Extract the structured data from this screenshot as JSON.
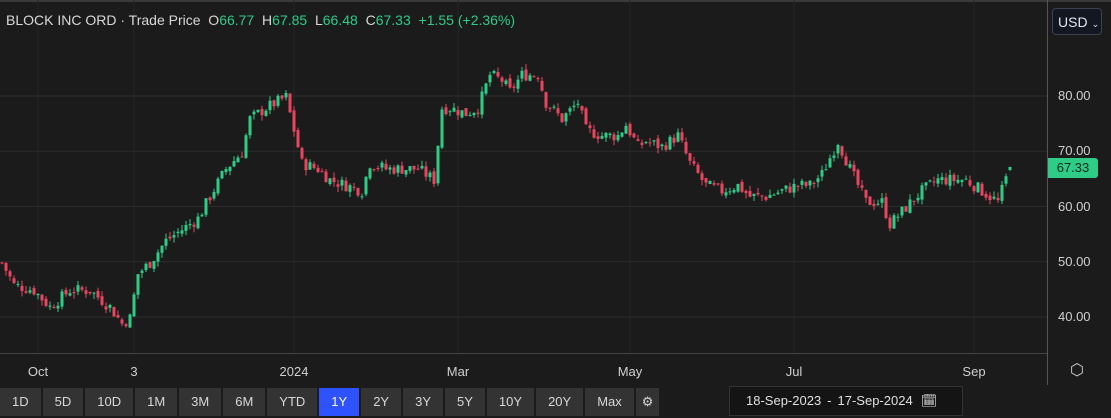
{
  "header": {
    "instrument": "BLOCK INC ORD",
    "separator": "·",
    "price_type": "Trade Price",
    "open_label": "O",
    "open": "66.77",
    "high_label": "H",
    "high": "67.85",
    "low_label": "L",
    "low": "66.48",
    "close_label": "C",
    "close": "67.33",
    "change": "+1.55 (+2.36%)"
  },
  "currency": {
    "selected": "USD",
    "icon": "chevron-down-icon"
  },
  "last_price_label": "67.33",
  "range_buttons": [
    "1D",
    "5D",
    "10D",
    "1M",
    "3M",
    "6M",
    "YTD",
    "1Y",
    "2Y",
    "3Y",
    "5Y",
    "10Y",
    "20Y",
    "Max"
  ],
  "active_range": "1Y",
  "date_range": {
    "from": "18-Sep-2023",
    "sep": "-",
    "to": "17-Sep-2024"
  },
  "colors": {
    "up": "#2ecc87",
    "down": "#e8455f",
    "background": "#1b1b1b",
    "active": "#2f52ff"
  },
  "chart_data": {
    "type": "candlestick",
    "title": "BLOCK INC ORD · Trade Price",
    "ylim": [
      35,
      90
    ],
    "y_ticks": [
      "80.00",
      "70.00",
      "60.00",
      "50.00",
      "40.00"
    ],
    "y_tick_values": [
      80,
      70,
      60,
      50,
      40
    ],
    "x_ticks": [
      "Oct",
      "3",
      "2024",
      "Mar",
      "May",
      "Jul",
      "Sep"
    ],
    "x_tick_days": [
      9,
      33,
      73,
      114,
      157,
      198,
      243
    ],
    "total_days": 253,
    "close_trace": [
      [
        0,
        50
      ],
      [
        3,
        46
      ],
      [
        8,
        45
      ],
      [
        12,
        42
      ],
      [
        17,
        45
      ],
      [
        22,
        45
      ],
      [
        27,
        42
      ],
      [
        30,
        39
      ],
      [
        32,
        40
      ],
      [
        34,
        48
      ],
      [
        37,
        50
      ],
      [
        41,
        54
      ],
      [
        45,
        56
      ],
      [
        49,
        58
      ],
      [
        52,
        62
      ],
      [
        56,
        67
      ],
      [
        60,
        70
      ],
      [
        62,
        76
      ],
      [
        66,
        78
      ],
      [
        71,
        80
      ],
      [
        73,
        74
      ],
      [
        75,
        68
      ],
      [
        79,
        67
      ],
      [
        82,
        65
      ],
      [
        86,
        64
      ],
      [
        90,
        63
      ],
      [
        92,
        68
      ],
      [
        96,
        67
      ],
      [
        100,
        67
      ],
      [
        104,
        67
      ],
      [
        108,
        65
      ],
      [
        110,
        78
      ],
      [
        112,
        78
      ],
      [
        116,
        77
      ],
      [
        119,
        78
      ],
      [
        122,
        84
      ],
      [
        125,
        83
      ],
      [
        127,
        81
      ],
      [
        130,
        84
      ],
      [
        134,
        84
      ],
      [
        136,
        79
      ],
      [
        140,
        76
      ],
      [
        144,
        79
      ],
      [
        146,
        74
      ],
      [
        150,
        73
      ],
      [
        154,
        73
      ],
      [
        156,
        75
      ],
      [
        159,
        71
      ],
      [
        161,
        72
      ],
      [
        165,
        71
      ],
      [
        169,
        73
      ],
      [
        172,
        68
      ],
      [
        176,
        64
      ],
      [
        180,
        63
      ],
      [
        184,
        64
      ],
      [
        187,
        62
      ],
      [
        191,
        62
      ],
      [
        195,
        63
      ],
      [
        199,
        64
      ],
      [
        202,
        64
      ],
      [
        205,
        66
      ],
      [
        209,
        72
      ],
      [
        212,
        67
      ],
      [
        216,
        61
      ],
      [
        220,
        61
      ],
      [
        222,
        57
      ],
      [
        226,
        60
      ],
      [
        230,
        63
      ],
      [
        234,
        65
      ],
      [
        237,
        65
      ],
      [
        241,
        65
      ],
      [
        245,
        63
      ],
      [
        249,
        61
      ],
      [
        252,
        67.33
      ]
    ]
  }
}
